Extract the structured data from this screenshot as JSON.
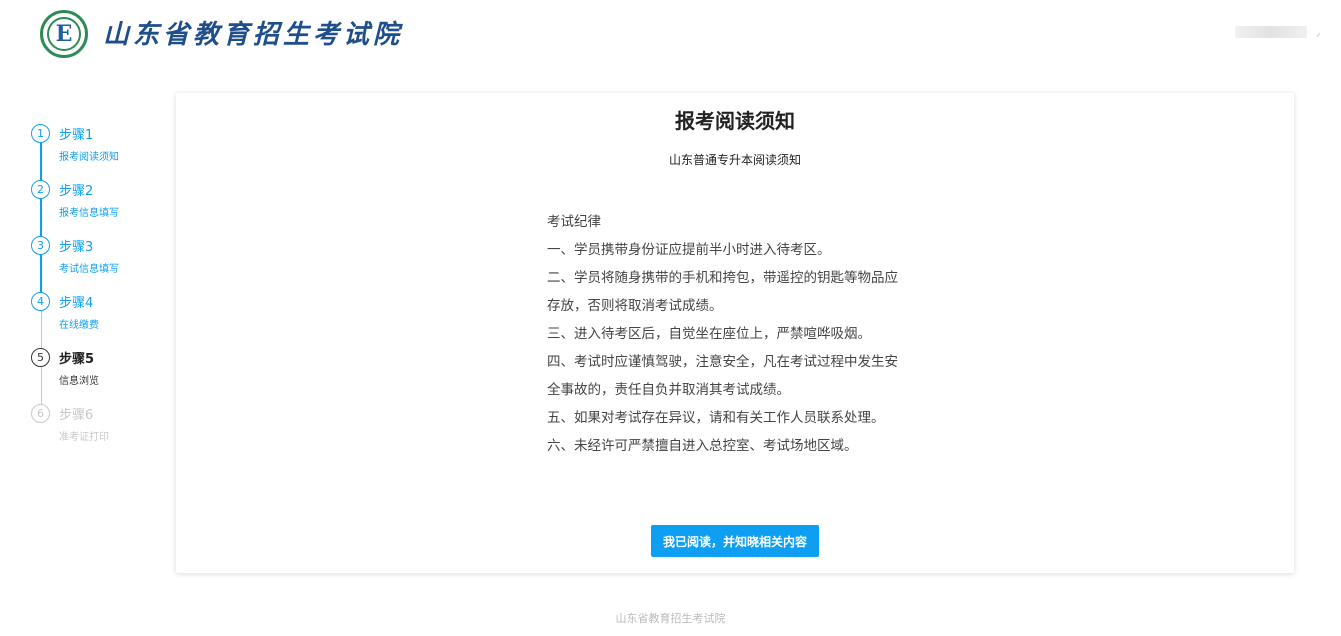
{
  "header": {
    "logo_letter": "E",
    "site_title": "山东省教育招生考试院"
  },
  "steps": [
    {
      "number": "1",
      "title": "步骤1",
      "desc": "报考阅读须知",
      "state": "done"
    },
    {
      "number": "2",
      "title": "步骤2",
      "desc": "报考信息填写",
      "state": "done"
    },
    {
      "number": "3",
      "title": "步骤3",
      "desc": "考试信息填写",
      "state": "done"
    },
    {
      "number": "4",
      "title": "步骤4",
      "desc": "在线缴费",
      "state": "done"
    },
    {
      "number": "5",
      "title": "步骤5",
      "desc": "信息浏览",
      "state": "current"
    },
    {
      "number": "6",
      "title": "步骤6",
      "desc": "准考证打印",
      "state": "future"
    }
  ],
  "main": {
    "title": "报考阅读须知",
    "subtitle": "山东普通专升本阅读须知",
    "notice_lines": [
      "考试纪律",
      "一、学员携带身份证应提前半小时进入待考区。",
      "二、学员将随身携带的手机和挎包，带遥控的钥匙等物品应",
      "存放，否则将取消考试成绩。",
      "三、进入待考区后，自觉坐在座位上，严禁喧哗吸烟。",
      "四、考试时应谨慎驾驶，注意安全，凡在考试过程中发生安",
      "全事故的，责任自负并取消其考试成绩。",
      "五、如果对考试存在异议，请和有关工作人员联系处理。",
      "六、未经许可严禁擅自进入总控室、考试场地区域。"
    ],
    "agree_button": "我已阅读，并知晓相关内容"
  },
  "footer": {
    "text": "山东省教育招生考试院"
  },
  "colors": {
    "accent": "#0e9ff2",
    "title_blue": "#1f4e8c",
    "logo_green": "#2e8b57",
    "inactive": "#c8c8c8"
  }
}
